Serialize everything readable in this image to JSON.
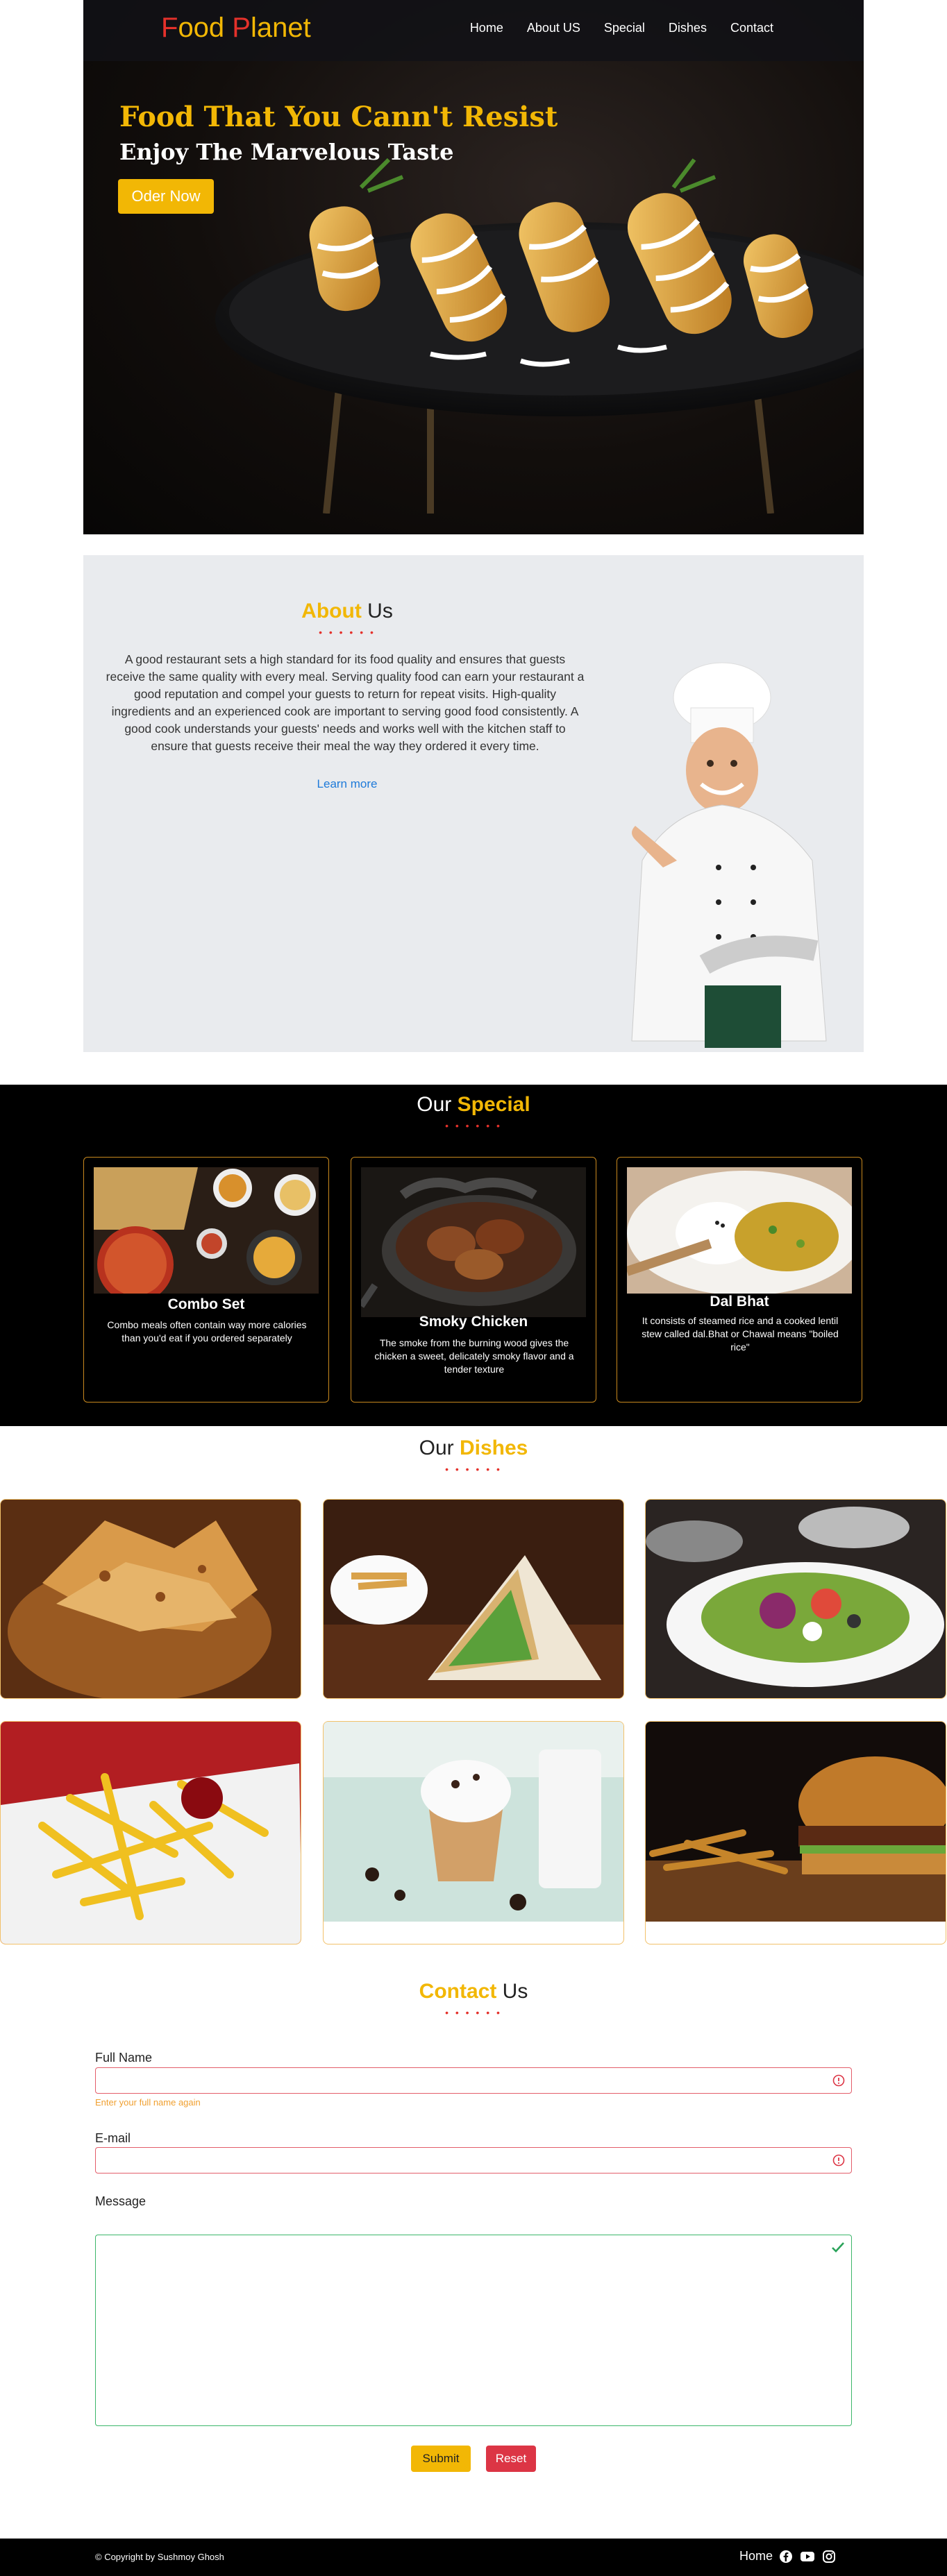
{
  "brand": {
    "first_letter": "F",
    "part1": "ood ",
    "second_letter": "P",
    "part2": "lanet"
  },
  "nav": [
    "Home",
    "About US",
    "Special",
    "Dishes",
    "Contact"
  ],
  "hero": {
    "title": "Food That You Cann't Resist",
    "subtitle": "Enjoy The Marvelous Taste",
    "order_button": "Oder Now"
  },
  "about": {
    "title_highlight": "About",
    "title_rest": " Us",
    "dots": "• • • • • •",
    "text": "A good restaurant sets a high standard for its food quality and ensures that guests receive the same quality with every meal. Serving quality food can earn your restaurant a good reputation and compel your guests to return for repeat visits. High-quality ingredients and an experienced cook are important to serving good food consistently. A good cook understands your guests' needs and works well with the kitchen staff to ensure that guests receive their meal the way they ordered it every time.",
    "learn_more": "Learn more"
  },
  "special": {
    "title_rest": "Our ",
    "title_highlight": "Special",
    "dots": "• • • • • •",
    "cards": [
      {
        "name": "Combo Set",
        "desc": "Combo meals often contain way more calories than you'd eat if you ordered separately"
      },
      {
        "name": "Smoky Chicken",
        "desc": "The smoke from the burning wood gives the chicken a sweet, delicately smoky flavor and a tender texture"
      },
      {
        "name": "Dal Bhat",
        "desc": "It consists of steamed rice and a cooked lentil stew called dal.Bhat or Chawal means \"boiled rice\""
      }
    ]
  },
  "dishes": {
    "title_rest": "Our ",
    "title_highlight": "Dishes",
    "dots": "• • • • • •"
  },
  "contact": {
    "title_highlight": "Contact",
    "title_rest": " Us",
    "dots": "• • • • • •",
    "full_name_label": "Full Name",
    "full_name_error": "Enter your full name again",
    "email_label": "E-mail",
    "message_label": "Message",
    "submit": "Submit",
    "reset": "Reset"
  },
  "footer": {
    "copyright": "© Copyright by Sushmoy Ghosh",
    "home": "Home"
  },
  "colors": {
    "accent": "#f2b705",
    "brand_red": "#e4312b",
    "danger": "#dc3545",
    "success": "#3cb76a"
  },
  "icons": [
    "warning-icon",
    "check-icon",
    "facebook-icon",
    "youtube-icon",
    "instagram-icon"
  ]
}
